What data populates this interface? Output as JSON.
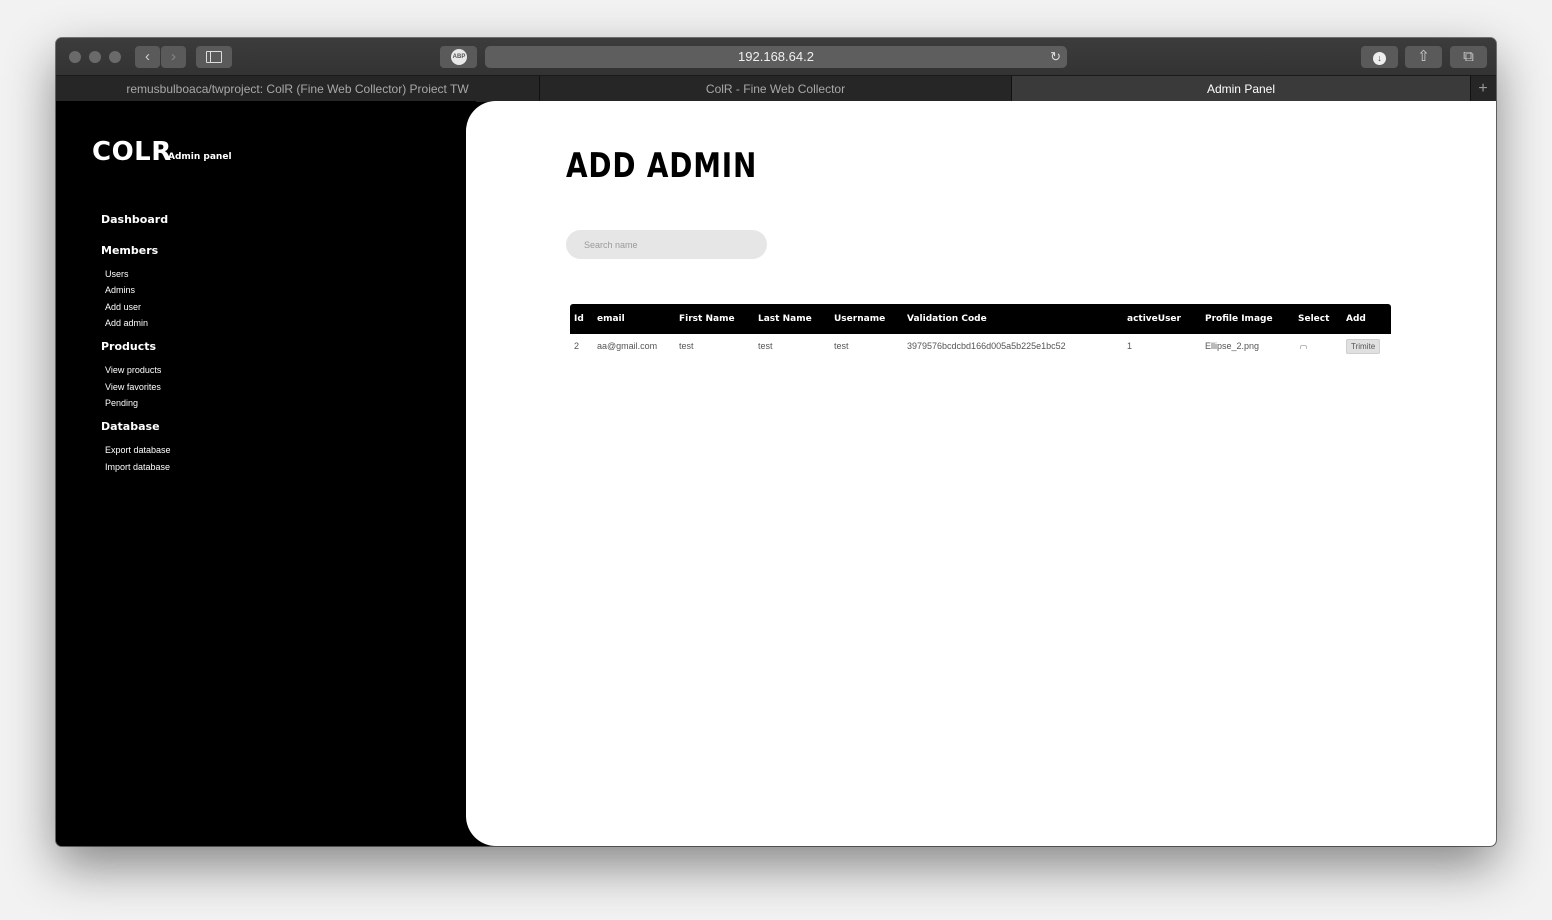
{
  "browser": {
    "url": "192.168.64.2",
    "tabs": [
      {
        "label": "remusbulboaca/twproject: ColR (Fine Web Collector) Proiect TW"
      },
      {
        "label": "ColR - Fine Web Collector"
      },
      {
        "label": "Admin Panel"
      }
    ],
    "abp_label": "ABP"
  },
  "sidebar": {
    "logo": "COLR",
    "logo_sub": "Admin panel",
    "sections": [
      {
        "heading": "Dashboard",
        "items": []
      },
      {
        "heading": "Members",
        "items": [
          "Users",
          "Admins",
          "Add user",
          "Add admin"
        ]
      },
      {
        "heading": "Products",
        "items": [
          "View products",
          "View favorites",
          "Pending"
        ]
      },
      {
        "heading": "Database",
        "items": [
          "Export database",
          "Import database"
        ]
      }
    ]
  },
  "main": {
    "title": "ADD ADMIN",
    "search_placeholder": "Search name",
    "table": {
      "headers": [
        "Id",
        "email",
        "First Name",
        "Last Name",
        "Username",
        "Validation Code",
        "activeUser",
        "Profile Image",
        "Select",
        "Add"
      ],
      "rows": [
        {
          "id": "2",
          "email": "aa@gmail.com",
          "first_name": "test",
          "last_name": "test",
          "username": "test",
          "validation_code": "3979576bcdcbd166d005a5b225e1bc52",
          "active_user": "1",
          "profile_image": "Ellipse_2.png",
          "add_label": "Trimite"
        }
      ]
    }
  }
}
